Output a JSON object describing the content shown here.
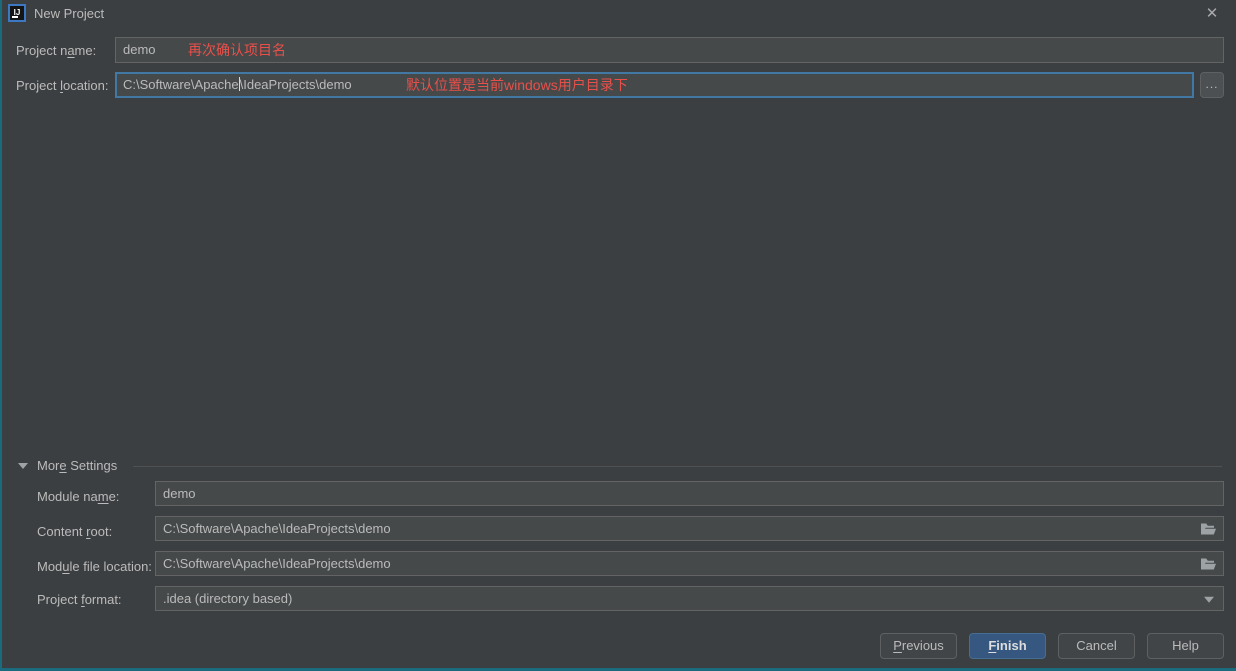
{
  "window": {
    "title": "New Project",
    "app_icon_text": "IJ",
    "close_glyph": "✕"
  },
  "form": {
    "project_name": {
      "label": {
        "pre": "Project n",
        "key": "a",
        "post": "me:"
      },
      "value": "demo",
      "annotation": "再次确认项目名"
    },
    "project_location": {
      "label": {
        "pre": "Project ",
        "key": "l",
        "post": "ocation:"
      },
      "value_before_caret": "C:\\Software\\Apache",
      "value_after_caret": "\\IdeaProjects\\demo",
      "annotation": "默认位置是当前windows用户目录下",
      "browse_label": "..."
    },
    "more_settings": {
      "label": {
        "pre": "Mor",
        "key": "e",
        "post": " Settings"
      }
    },
    "module_name": {
      "label": {
        "pre": "Module na",
        "key": "m",
        "post": "e:"
      },
      "value": "demo"
    },
    "content_root": {
      "label": {
        "pre": "Content ",
        "key": "r",
        "post": "oot:"
      },
      "value": "C:\\Software\\Apache\\IdeaProjects\\demo"
    },
    "module_file_location": {
      "label": {
        "pre": "Mod",
        "key": "u",
        "post": "le file location:"
      },
      "value": "C:\\Software\\Apache\\IdeaProjects\\demo"
    },
    "project_format": {
      "label": {
        "pre": "Project ",
        "key": "f",
        "post": "ormat:"
      },
      "value": ".idea (directory based)"
    }
  },
  "buttons": {
    "previous": {
      "pre": "",
      "key": "P",
      "post": "revious"
    },
    "finish": {
      "pre": "",
      "key": "F",
      "post": "inish"
    },
    "cancel": {
      "label": "Cancel"
    },
    "help": {
      "label": "Help"
    }
  },
  "colors": {
    "dialog_bg": "#3c3f41",
    "field_bg": "#45494a",
    "field_border": "#646464",
    "focus_border": "#4178a4",
    "annotation_red": "#e8504a",
    "default_button_bg": "#365880",
    "window_edge_teal": "#196b7d",
    "text": "#bbbbbb"
  }
}
